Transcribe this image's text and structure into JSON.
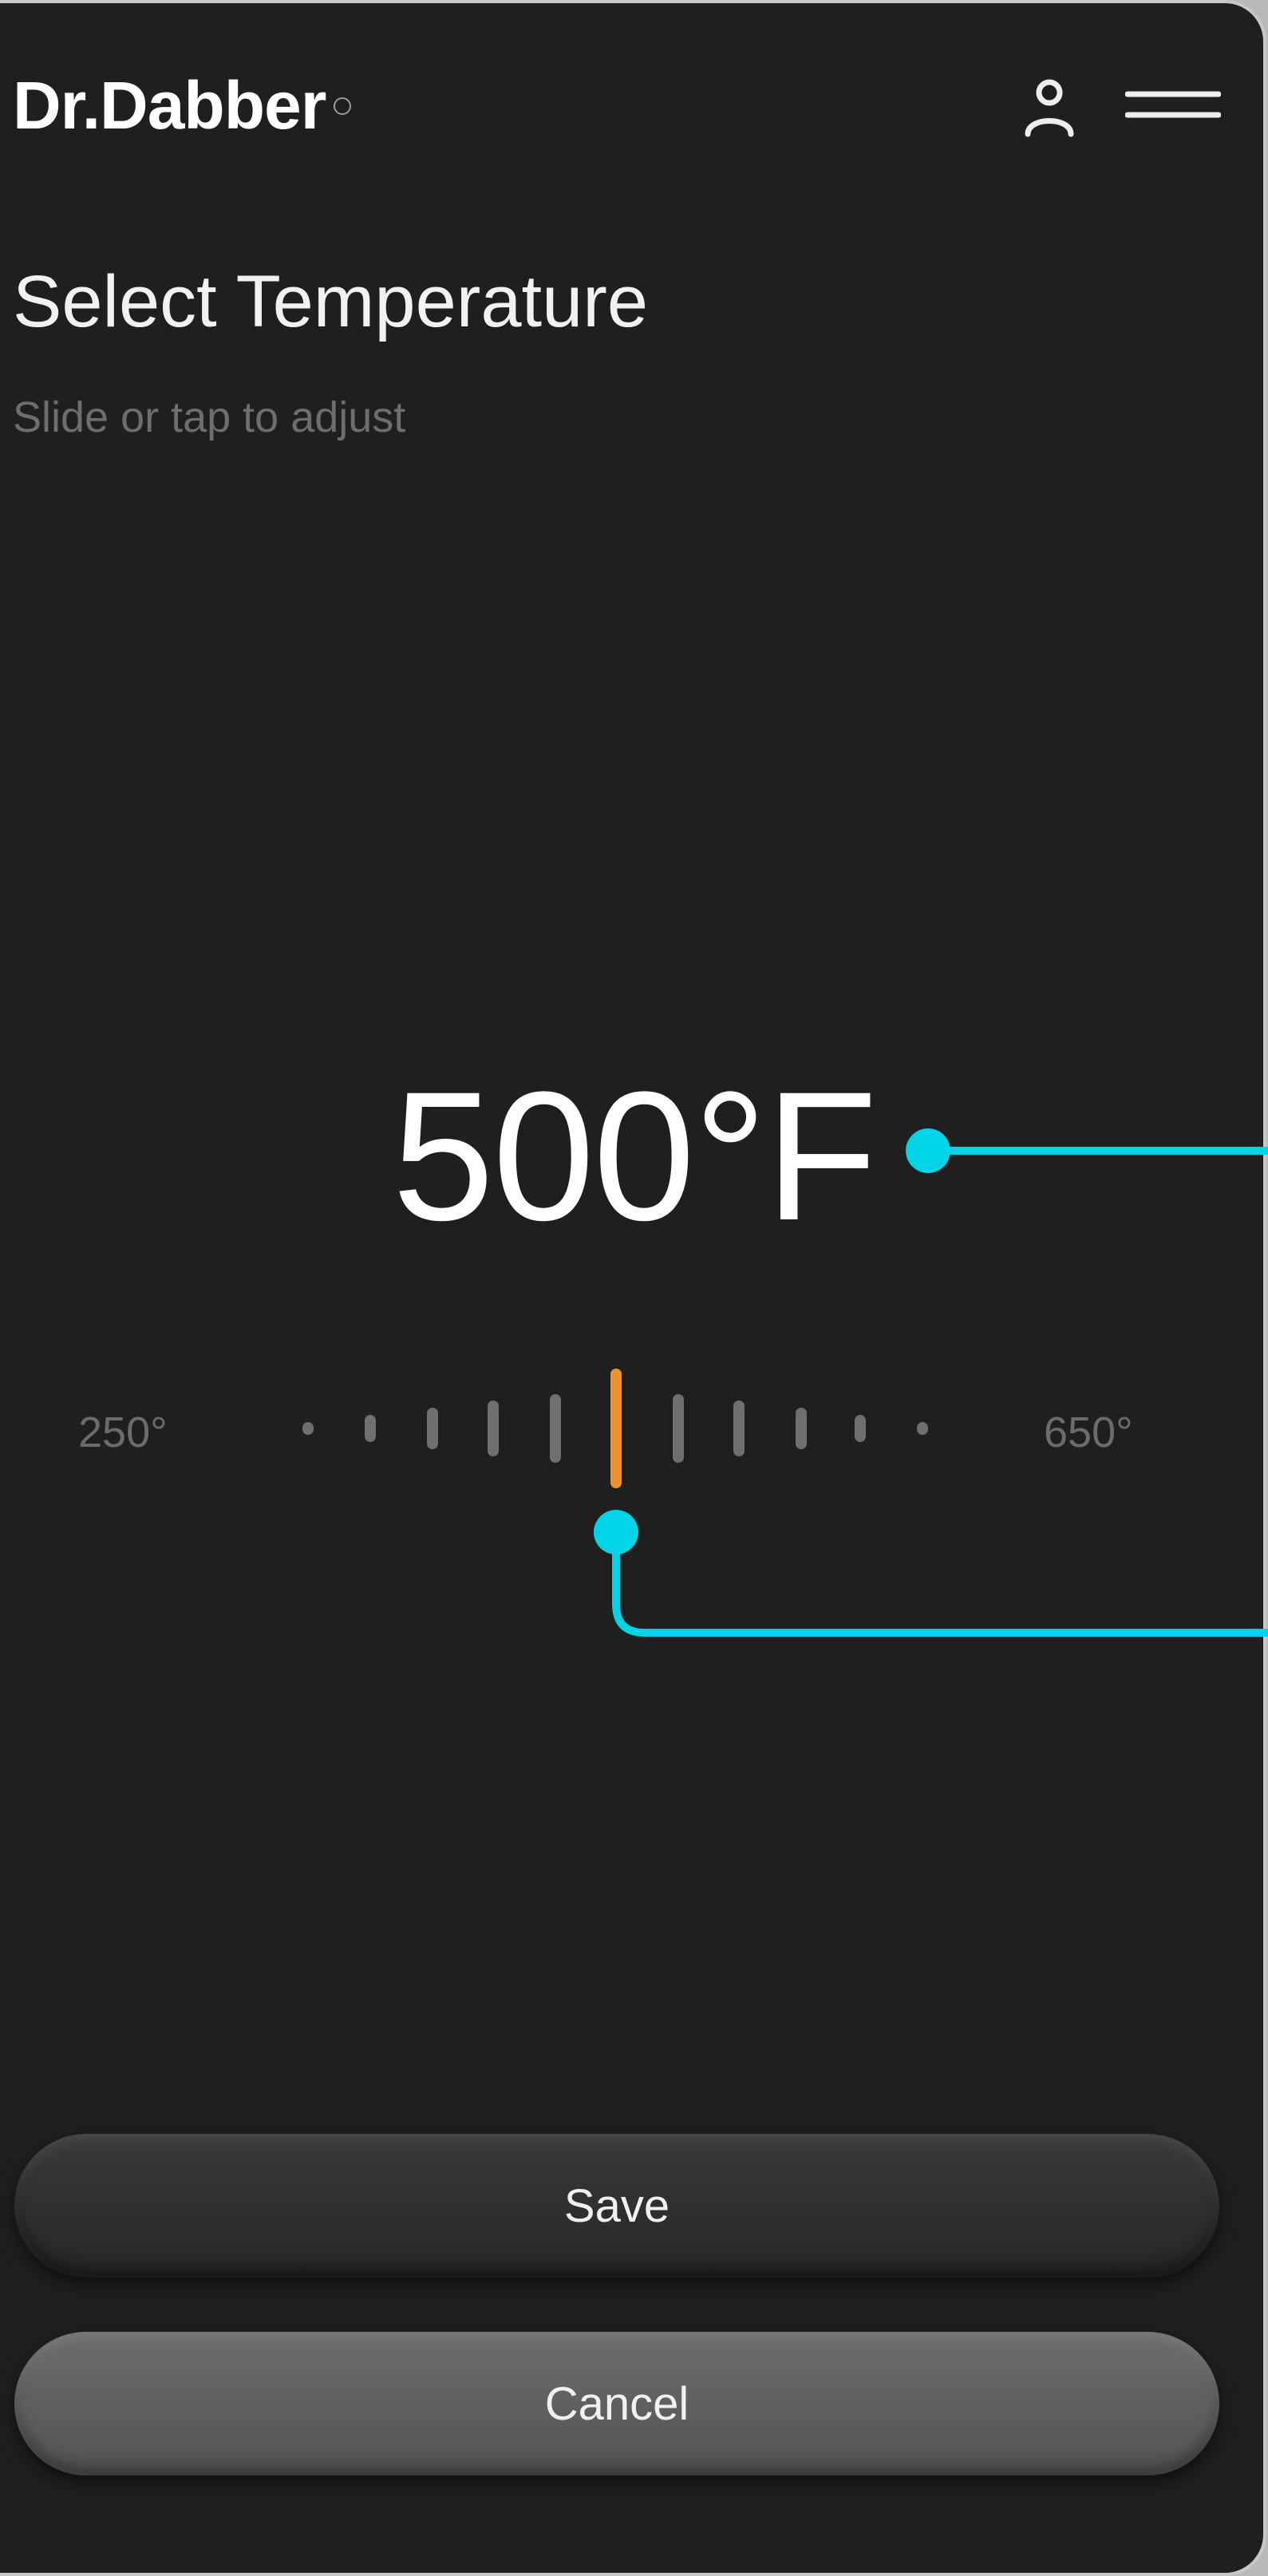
{
  "header": {
    "logo_text": "Dr.Dabber",
    "profile_icon": "user-icon",
    "menu_icon": "hamburger-menu-icon"
  },
  "page": {
    "title": "Select Temperature",
    "subtitle": "Slide or tap to adjust"
  },
  "temperature": {
    "value": 500,
    "unit": "°F",
    "display": "500°F",
    "min_label": "250°",
    "max_label": "650°",
    "min": 250,
    "max": 650,
    "tick_count": 11,
    "active_tick_index": 5
  },
  "buttons": {
    "save_label": "Save",
    "cancel_label": "Cancel"
  },
  "colors": {
    "background": "#1f1f1f",
    "accent_active_tick": "#f0922b",
    "callout_line": "#00d4e6",
    "text_primary": "#ffffff",
    "text_muted": "#6e6e6e"
  }
}
